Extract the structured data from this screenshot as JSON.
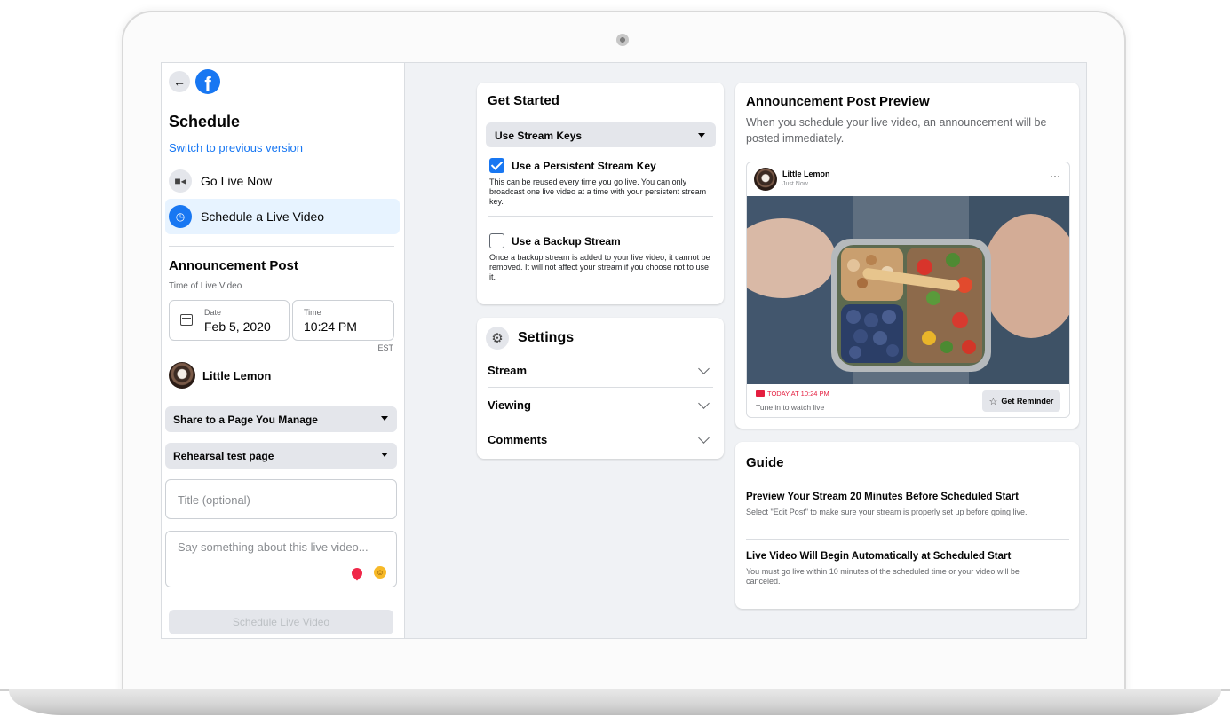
{
  "sidebar": {
    "title": "Schedule",
    "switch_link": "Switch to previous version",
    "nav": [
      {
        "label": "Go Live Now"
      },
      {
        "label": "Schedule a Live Video"
      }
    ],
    "announcement": {
      "title": "Announcement Post",
      "subtitle": "Time of Live Video",
      "date_label": "Date",
      "date_value": "Feb 5, 2020",
      "time_label": "Time",
      "time_value": "10:24 PM",
      "timezone": "EST"
    },
    "page_name": "Little Lemon",
    "share_select": "Share to a Page You Manage",
    "page_select": "Rehearsal test page",
    "title_placeholder": "Title (optional)",
    "description_placeholder": "Say something about this live video...",
    "schedule_button": "Schedule Live Video"
  },
  "get_started": {
    "title": "Get Started",
    "select": "Use Stream Keys",
    "options": [
      {
        "label": "Use a Persistent Stream Key",
        "checked": true,
        "description": "This can be reused every time you go live. You can only broadcast one live video at a time with your persistent stream key."
      },
      {
        "label": "Use a Backup Stream",
        "checked": false,
        "description": "Once a backup stream is added to your live video, it cannot be removed. It will not affect your stream if you choose not to use it."
      }
    ]
  },
  "settings": {
    "title": "Settings",
    "rows": [
      {
        "label": "Stream"
      },
      {
        "label": "Viewing"
      },
      {
        "label": "Comments"
      }
    ]
  },
  "preview": {
    "title": "Announcement Post Preview",
    "subtitle": "When you schedule your live video, an announcement will be posted immediately.",
    "post": {
      "page_name": "Little Lemon",
      "time": "Just Now",
      "more": "···",
      "live_time": "TODAY AT 10:24 PM",
      "tune_in": "Tune in to watch live",
      "reminder_button": "Get Reminder"
    }
  },
  "guide": {
    "title": "Guide",
    "items": [
      {
        "heading": "Preview Your Stream 20 Minutes Before Scheduled Start",
        "text": "Select \"Edit Post\" to make sure your stream is properly set up before going live."
      },
      {
        "heading": "Live Video Will Begin Automatically at Scheduled Start",
        "text": "You must go live within 10 minutes of the scheduled time or your video will be canceled."
      }
    ]
  },
  "colors": {
    "accent": "#1877f2",
    "background": "#f0f2f5",
    "live_red": "#e41e3f"
  },
  "icons": {
    "back": "arrow-left-icon",
    "logo": "facebook-logo-icon",
    "go_live": "video-camera-icon",
    "schedule": "clock-icon",
    "calendar": "calendar-icon",
    "location": "location-pin-icon",
    "emoji": "smiley-icon",
    "settings": "gear-icon",
    "reminder": "star-icon"
  }
}
